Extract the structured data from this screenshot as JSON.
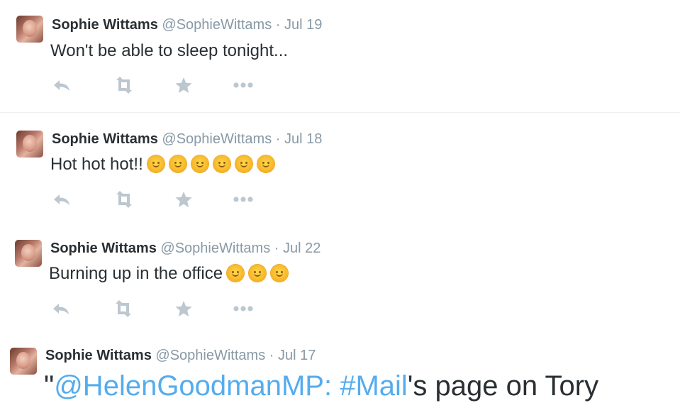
{
  "colors": {
    "name": "#292f33",
    "muted": "#8899a6",
    "link": "#55acee",
    "action_icon": "#bcc7d0"
  },
  "tweets": [
    {
      "name": "Sophie Wittams",
      "handle": "@SophieWittams",
      "separator": "·",
      "date": "Jul 19",
      "text": "Won't be able to sleep tonight...",
      "emoji_count": 0
    },
    {
      "name": "Sophie Wittams",
      "handle": "@SophieWittams",
      "separator": "·",
      "date": "Jul 18",
      "text": "Hot hot hot!!",
      "emoji": "sun-with-face-icon",
      "emoji_count": 6
    },
    {
      "name": "Sophie Wittams",
      "handle": "@SophieWittams",
      "separator": "·",
      "date": "Jul 22",
      "text": "Burning up in the office",
      "emoji": "sun-with-face-icon",
      "emoji_count": 3
    },
    {
      "name": "Sophie Wittams",
      "handle": "@SophieWittams",
      "separator": "·",
      "date": "Jul 17",
      "text_quote": "\"",
      "text_link": "@HelenGoodmanMP: #Mail",
      "text_rest": "'s page on Tory"
    }
  ],
  "action_icons": [
    "reply-icon",
    "retweet-icon",
    "favorite-star-icon",
    "more-options-icon"
  ]
}
